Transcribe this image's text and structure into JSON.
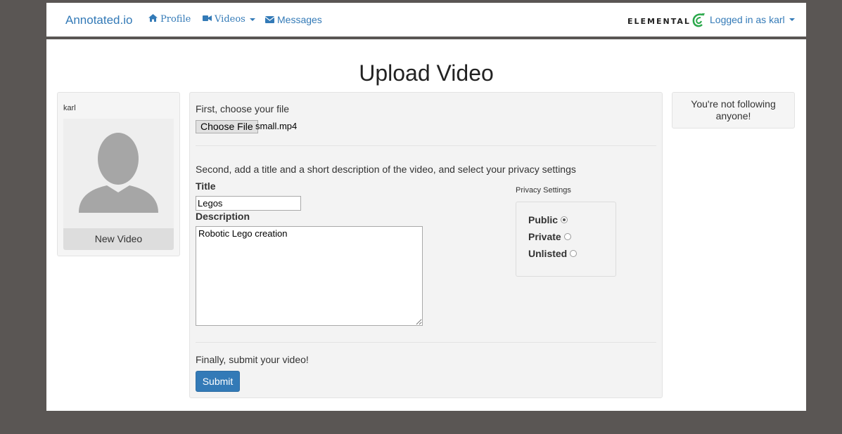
{
  "navbar": {
    "brand": "Annotated.io",
    "profile_label": "Profile",
    "videos_label": "Videos",
    "messages_label": "Messages",
    "logo_text": "ELEMENTAL",
    "user_menu_label": "Logged in as karl"
  },
  "page": {
    "title": "Upload Video"
  },
  "sidebar": {
    "username": "karl",
    "new_video_label": "New Video"
  },
  "form": {
    "step1_label": "First, choose your file",
    "choose_file_label": "Choose File",
    "file_name": "small.mp4",
    "step2_label": "Second, add a title and a short description of the video, and select your privacy settings",
    "title_label": "Title",
    "title_value": "Legos",
    "description_label": "Description",
    "description_value": "Robotic Lego creation",
    "privacy_title": "Privacy Settings",
    "privacy_options": [
      "Public",
      "Private",
      "Unlisted"
    ],
    "privacy_selected": "Public",
    "step3_label": "Finally, submit your video!",
    "submit_label": "Submit"
  },
  "following": {
    "message": "You're not following anyone!"
  },
  "colors": {
    "accent": "#337ab7",
    "background": "#5a5654",
    "panel": "#f3f3f3",
    "logo_green": "#2aa84a"
  },
  "icons": {
    "profile": "home-icon",
    "videos": "video-camera-icon",
    "messages": "envelope-icon",
    "avatar": "user-silhouette-icon",
    "logo": "elemental-swirl-icon"
  }
}
